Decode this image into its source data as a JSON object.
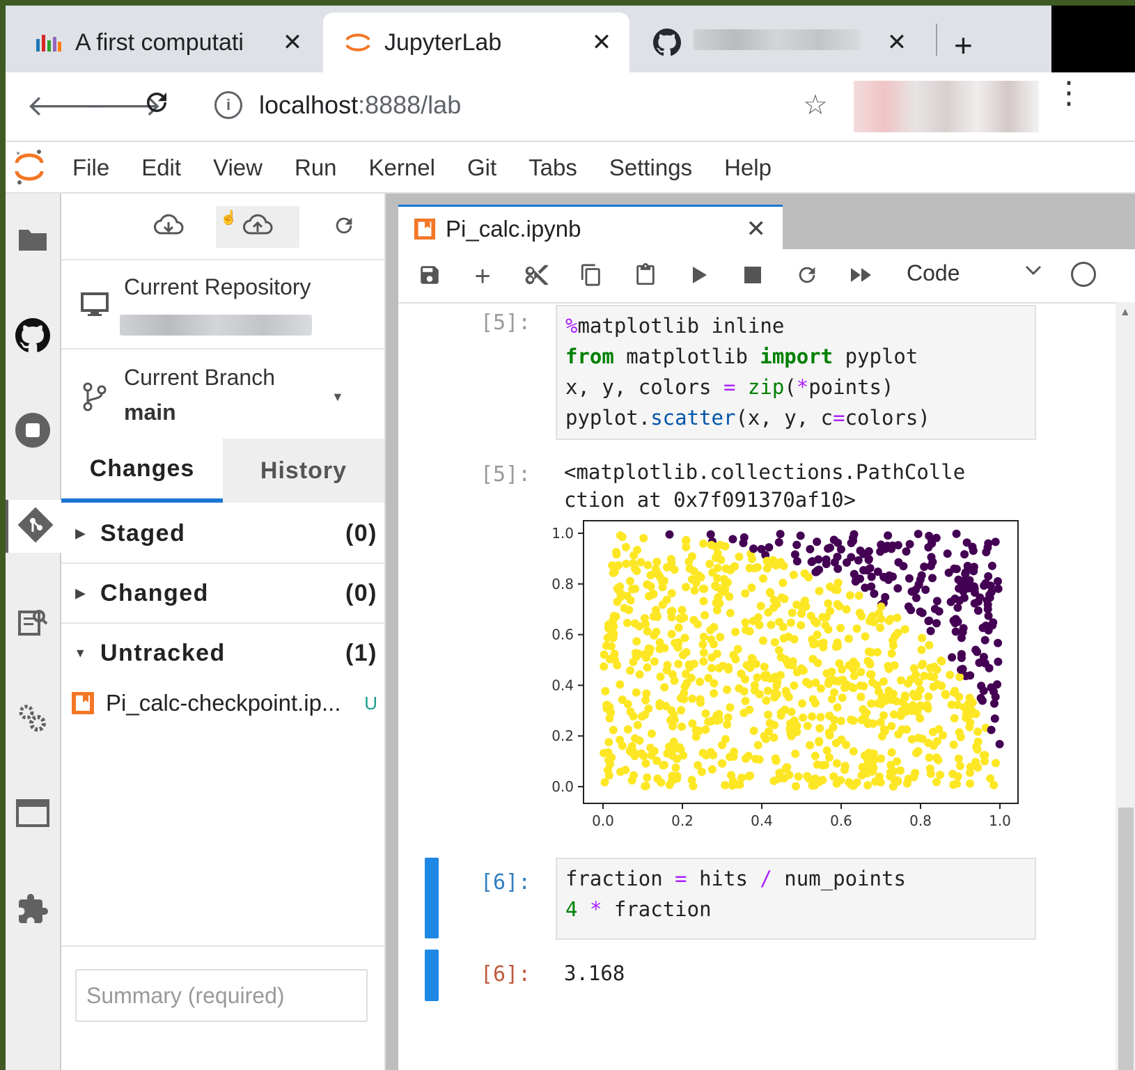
{
  "browser": {
    "tabs": [
      {
        "title": "A first computati",
        "active": false,
        "icon": "chart-favicon-icon"
      },
      {
        "title": "JupyterLab",
        "active": true,
        "icon": "jupyter-favicon-icon"
      },
      {
        "title": "",
        "active": false,
        "icon": "github-favicon-icon",
        "blurred": true
      }
    ],
    "url_host": "localhost",
    "url_path": ":8888/lab"
  },
  "menu": [
    "File",
    "Edit",
    "View",
    "Run",
    "Kernel",
    "Git",
    "Tabs",
    "Settings",
    "Help"
  ],
  "git": {
    "current_repository_label": "Current Repository",
    "current_branch_label": "Current Branch",
    "branch": "main",
    "tabs": [
      "Changes",
      "History"
    ],
    "groups": [
      {
        "name": "Staged",
        "count": "(0)",
        "expanded": false
      },
      {
        "name": "Changed",
        "count": "(0)",
        "expanded": false
      },
      {
        "name": "Untracked",
        "count": "(1)",
        "expanded": true
      }
    ],
    "untracked_file": {
      "name": "Pi_calc-checkpoint.ip...",
      "status": "U"
    },
    "summary_placeholder": "Summary (required)"
  },
  "notebook": {
    "filename": "Pi_calc.ipynb",
    "cell_type": "Code",
    "cells": [
      {
        "in_prompt": "[5]:",
        "out_prompt": "[5]:",
        "output_text_line1": "<matplotlib.collections.PathColle",
        "output_text_line2": "ction at 0x7f091370af10>"
      },
      {
        "in_prompt": "[6]:",
        "out_prompt": "[6]:",
        "output_value": "3.168"
      }
    ]
  },
  "chart_data": {
    "type": "scatter",
    "xlim": [
      0.0,
      1.0
    ],
    "ylim": [
      0.0,
      1.0
    ],
    "xticks": [
      "0.0",
      "0.2",
      "0.4",
      "0.6",
      "0.8",
      "1.0"
    ],
    "yticks": [
      "0.0",
      "0.2",
      "0.4",
      "0.6",
      "0.8",
      "1.0"
    ],
    "num_points": 1000,
    "hits": 792,
    "colors": {
      "inside": "#fde725",
      "outside": "#440154"
    },
    "points_note": "",
    "grid": false
  }
}
